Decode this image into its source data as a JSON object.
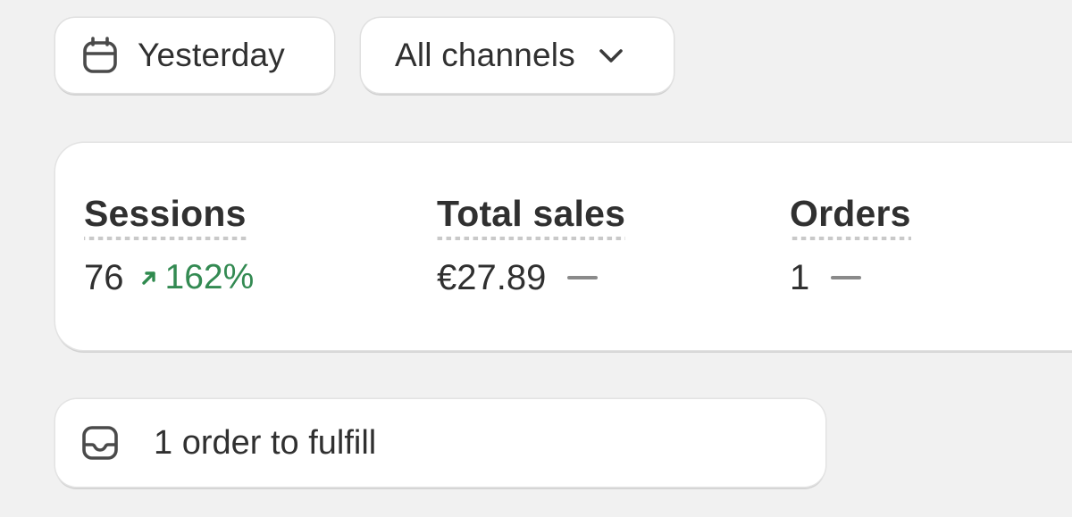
{
  "filters": {
    "date_label": "Yesterday",
    "channel_label": "All channels"
  },
  "metrics": [
    {
      "title": "Sessions",
      "value": "76",
      "change": "162%",
      "trend": "up"
    },
    {
      "title": "Total sales",
      "value": "€27.89",
      "change": null,
      "trend": "none"
    },
    {
      "title": "Orders",
      "value": "1",
      "change": null,
      "trend": "none"
    }
  ],
  "tasks": {
    "fulfill_label": "1 order to fulfill"
  },
  "colors": {
    "background": "#f1f1f1",
    "card": "#ffffff",
    "text": "#303030",
    "trend_up": "#338a52",
    "neutral_dash": "#8a8a8a"
  },
  "icons": {
    "date": "calendar-icon",
    "channel": "chevron-down-icon",
    "fulfill": "inbox-icon",
    "trend": "arrow-up-right-icon"
  }
}
